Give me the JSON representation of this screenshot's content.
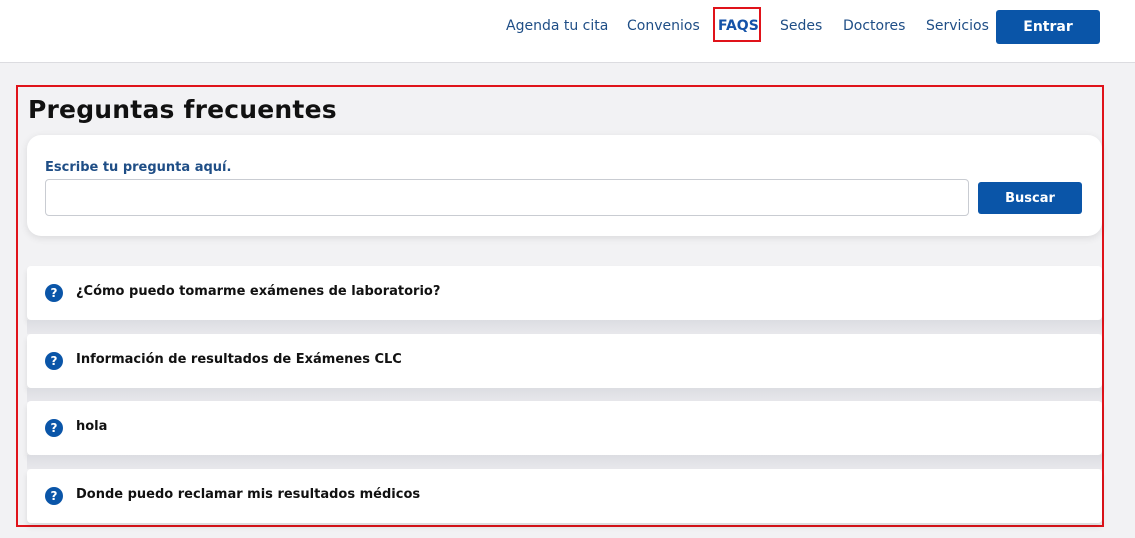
{
  "nav": {
    "links": [
      {
        "label": "Agenda tu cita"
      },
      {
        "label": "Convenios"
      },
      {
        "label": "FAQS"
      },
      {
        "label": "Sedes"
      },
      {
        "label": "Doctores"
      },
      {
        "label": "Servicios"
      }
    ],
    "login_label": "Entrar"
  },
  "page": {
    "title": "Preguntas frecuentes"
  },
  "search": {
    "label": "Escribe tu pregunta aquí.",
    "value": "",
    "placeholder": "",
    "button_label": "Buscar"
  },
  "faqs": [
    {
      "question": "¿Cómo puedo tomarme exámenes de laboratorio?",
      "icon": "question-circle-icon"
    },
    {
      "question": "Información de resultados de Exámenes CLC",
      "icon": "question-circle-icon"
    },
    {
      "question": "hola",
      "icon": "question-circle-icon"
    },
    {
      "question": "Donde puedo reclamar mis resultados médicos",
      "icon": "question-circle-icon"
    }
  ],
  "colors": {
    "primary": "#0a55a8",
    "link": "#1f4e86",
    "highlight": "#e0131a",
    "background": "#f2f2f4"
  }
}
